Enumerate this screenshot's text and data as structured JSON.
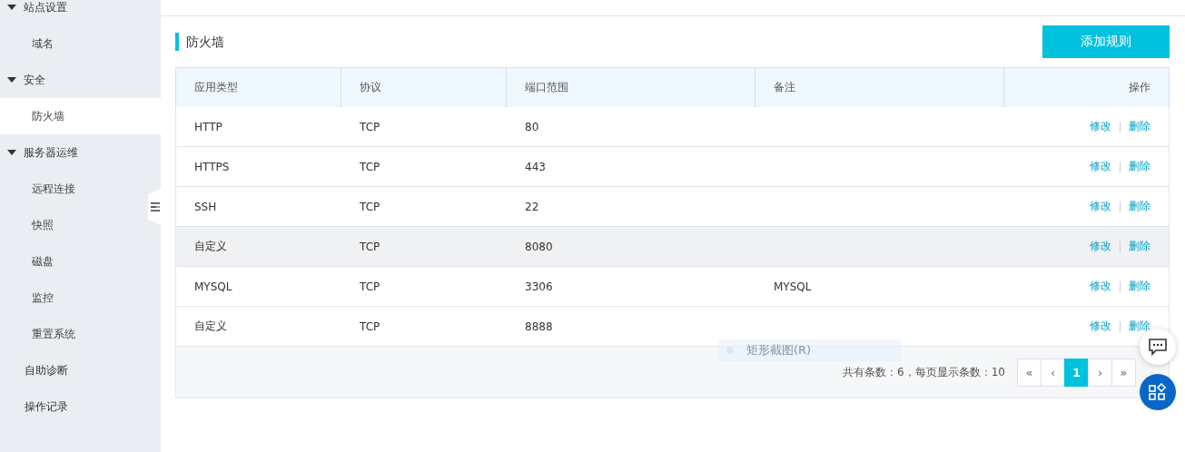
{
  "sidebar": {
    "items": [
      {
        "label": "站点设置",
        "expanded": true,
        "selected": false,
        "children": [
          {
            "label": "域名",
            "selected": false
          }
        ]
      },
      {
        "label": "安全",
        "expanded": true,
        "selected": false,
        "children": [
          {
            "label": "防火墙",
            "selected": true
          }
        ]
      },
      {
        "label": "服务器运维",
        "expanded": true,
        "selected": false,
        "children": [
          {
            "label": "远程连接",
            "selected": false
          },
          {
            "label": "快照",
            "selected": false
          },
          {
            "label": "磁盘",
            "selected": false
          },
          {
            "label": "监控",
            "selected": false
          },
          {
            "label": "重置系统",
            "selected": false
          }
        ]
      },
      {
        "label": "自助诊断",
        "selected": false
      },
      {
        "label": "操作记录",
        "selected": false
      }
    ]
  },
  "section_title": "防火墙",
  "add_button": "添加规则",
  "table": {
    "columns": [
      "应用类型",
      "协议",
      "端口范围",
      "备注",
      "操作"
    ],
    "rows": [
      {
        "cells": [
          "HTTP",
          "TCP",
          "80",
          ""
        ],
        "actions": [
          "修改",
          "删除"
        ],
        "highlighted": false
      },
      {
        "cells": [
          "HTTPS",
          "TCP",
          "443",
          ""
        ],
        "actions": [
          "修改",
          "删除"
        ],
        "highlighted": false
      },
      {
        "cells": [
          "SSH",
          "TCP",
          "22",
          ""
        ],
        "actions": [
          "修改",
          "删除"
        ],
        "highlighted": false
      },
      {
        "cells": [
          "自定义",
          "TCP",
          "8080",
          ""
        ],
        "actions": [
          "修改",
          "删除"
        ],
        "highlighted": true
      },
      {
        "cells": [
          "MYSQL",
          "TCP",
          "3306",
          "MYSQL"
        ],
        "actions": [
          "修改",
          "删除"
        ],
        "highlighted": false
      },
      {
        "cells": [
          "自定义",
          "TCP",
          "8888",
          ""
        ],
        "actions": [
          "修改",
          "删除"
        ],
        "highlighted": false
      }
    ]
  },
  "pagination": {
    "summary": "共有条数：6，每页显示条数：10",
    "pages": [
      {
        "label": "«",
        "selected": false
      },
      {
        "label": "‹",
        "selected": false
      },
      {
        "label": "1",
        "selected": true
      },
      {
        "label": "›",
        "selected": false
      },
      {
        "label": "»",
        "selected": false
      }
    ]
  },
  "overlay_menu_item": "矩形截图(R)"
}
